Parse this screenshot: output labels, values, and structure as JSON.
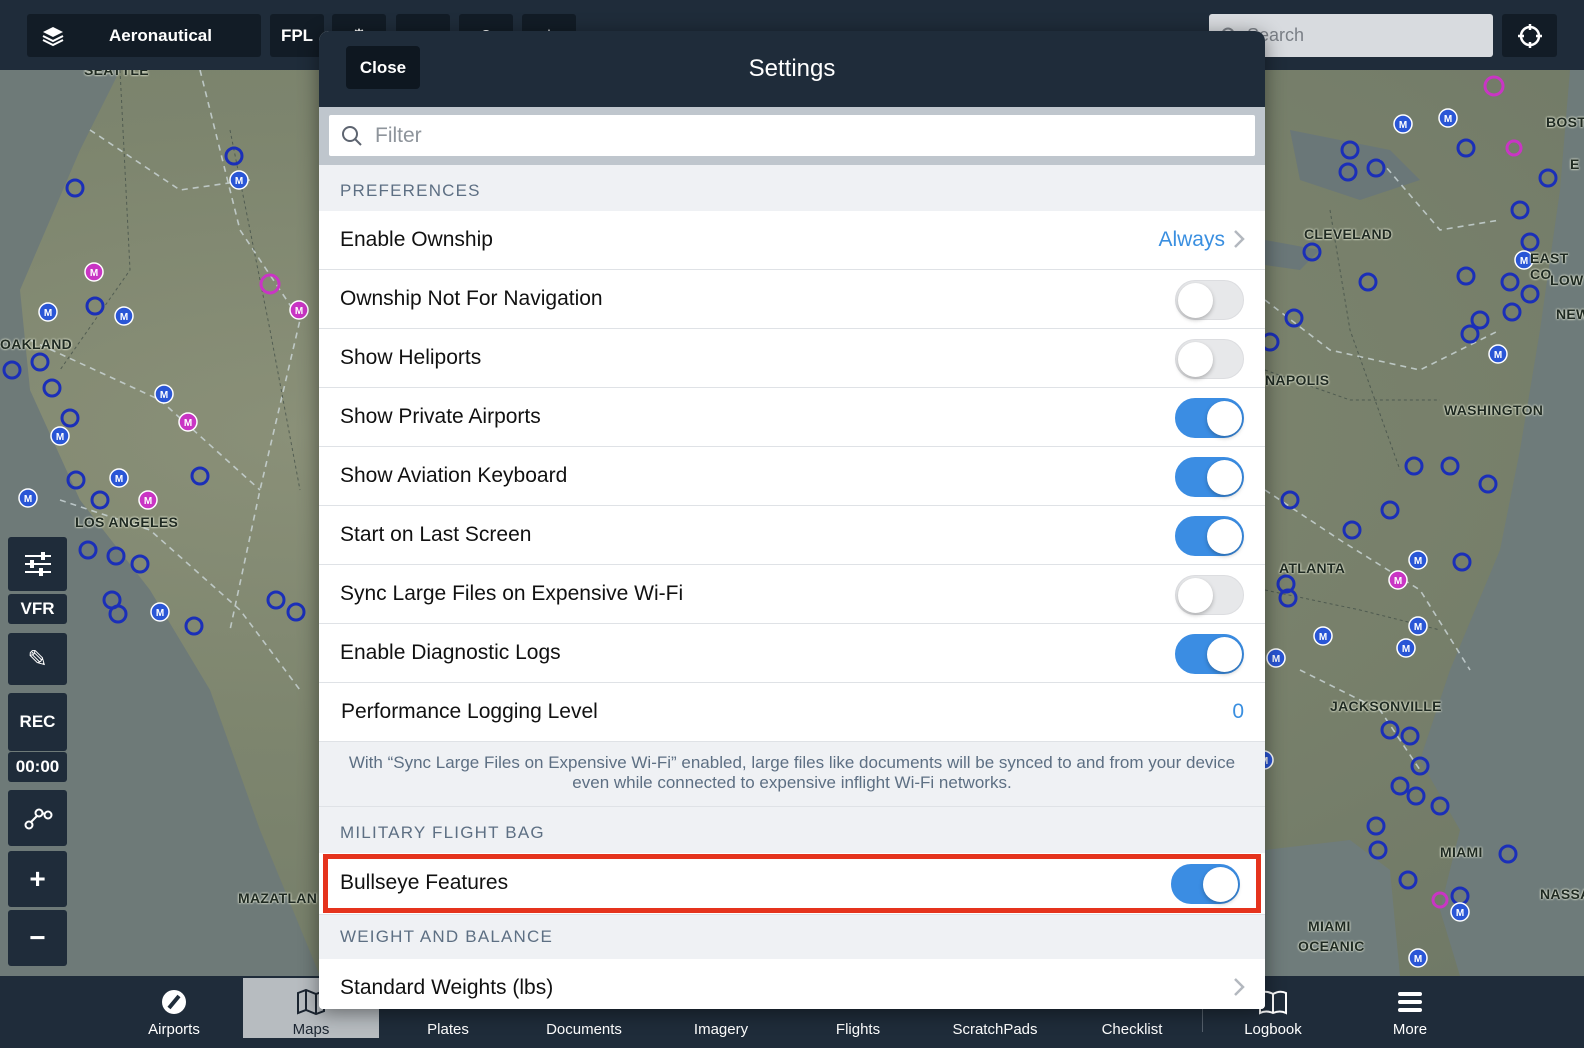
{
  "topbar": {
    "layers_label": "Aeronautical",
    "fpl_label": "FPL",
    "search_placeholder": "Search"
  },
  "map_labels": {
    "seattle": "SEATTLE",
    "oakland": "OAKLAND",
    "los_angeles": "LOS ANGELES",
    "mazatlan": "MAZATLAN",
    "cleveland": "CLEVELAND",
    "boston": "BOST",
    "east_coast": "EAST CO",
    "low": "LOW",
    "new": "NEW",
    "indianapolis": "NAPOLIS",
    "washington": "WASHINGTON",
    "atlanta": "ATLANTA",
    "jacksonville": "JACKSONVILLE",
    "miami": "MIAMI",
    "nassau": "NASSA",
    "miami_oceanic_1": "MIAMI",
    "miami_oceanic_2": "OCEANIC",
    "e": "E"
  },
  "left_tools": {
    "vfr": "VFR",
    "rec": "REC",
    "timer": "00:00"
  },
  "tabs": [
    {
      "label": "Airports",
      "icon": "airports-icon"
    },
    {
      "label": "Maps",
      "icon": "map-icon"
    },
    {
      "label": "Plates",
      "icon": "plates-icon"
    },
    {
      "label": "Documents",
      "icon": "documents-icon"
    },
    {
      "label": "Imagery",
      "icon": "imagery-icon"
    },
    {
      "label": "Flights",
      "icon": "flights-icon"
    },
    {
      "label": "ScratchPads",
      "icon": "scratchpads-icon"
    },
    {
      "label": "Checklist",
      "icon": "checklist-icon"
    },
    {
      "label": "Logbook",
      "icon": "logbook-icon"
    },
    {
      "label": "More",
      "icon": "more-icon"
    }
  ],
  "active_tab": "Maps",
  "settings": {
    "title": "Settings",
    "close_label": "Close",
    "filter_placeholder": "Filter",
    "preferences_header": "PREFERENCES",
    "rows": [
      {
        "label": "Enable Ownship",
        "type": "disclosure",
        "value": "Always"
      },
      {
        "label": "Ownship Not For Navigation",
        "type": "toggle",
        "on": false
      },
      {
        "label": "Show Heliports",
        "type": "toggle",
        "on": false
      },
      {
        "label": "Show Private Airports",
        "type": "toggle",
        "on": true
      },
      {
        "label": "Show Aviation Keyboard",
        "type": "toggle",
        "on": true
      },
      {
        "label": "Start on Last Screen",
        "type": "toggle",
        "on": true
      },
      {
        "label": "Sync Large Files on Expensive Wi-Fi",
        "type": "toggle",
        "on": false
      },
      {
        "label": "Enable Diagnostic Logs",
        "type": "toggle",
        "on": true
      },
      {
        "label": "Performance Logging Level",
        "type": "value",
        "value": "0"
      }
    ],
    "footnote": "With “Sync Large Files on Expensive Wi-Fi” enabled, large files like documents will be synced to and from your device even while connected to expensive inflight Wi-Fi networks.",
    "military_header": "MILITARY FLIGHT BAG",
    "bullseye": {
      "label": "Bullseye Features",
      "on": true
    },
    "weight_header": "WEIGHT AND BALANCE",
    "standard_weights": {
      "label": "Standard Weights (lbs)"
    }
  },
  "colors": {
    "toggle_on": "#3b8de3",
    "highlight": "#e5331d",
    "header_bg": "#1f2c3a",
    "link_blue": "#3a8fe0"
  }
}
